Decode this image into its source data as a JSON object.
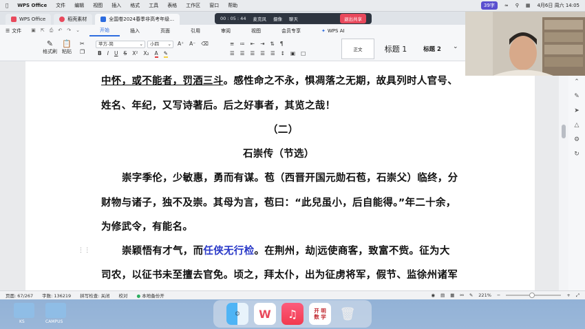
{
  "menubar": {
    "app": "WPS Office",
    "items": [
      "文件",
      "编辑",
      "视图",
      "插入",
      "格式",
      "工具",
      "表格",
      "工作区",
      "窗口",
      "帮助"
    ],
    "badge": "39字",
    "clock": "4月6日 周六 14:05"
  },
  "tabs": [
    {
      "label": "WPS Office",
      "color": "#e9495c"
    },
    {
      "label": "稻壳素材",
      "color": "#e9495c"
    },
    {
      "label": "全国卷2024春季非高考年级…",
      "color": "#2d6cdf"
    }
  ],
  "recording": {
    "time": "00 : 05 : 44",
    "mic": "麦克风",
    "camera": "摄像",
    "chat": "聊天",
    "stop": "退出共享"
  },
  "ribbon": {
    "file": "文件",
    "tabs": [
      "开始",
      "插入",
      "页面",
      "引用",
      "审阅",
      "视图",
      "会员专享"
    ],
    "active": "开始",
    "wpsai": "WPS AI",
    "format_painter": "格式刷",
    "paste": "粘贴",
    "font": "苹方-简",
    "size": "小四",
    "styles": [
      "正文",
      "标题 1",
      "标题 2"
    ]
  },
  "doc": {
    "l1a": "中怀，或不能者，罚酒三斗",
    "l1b": "。感性命之不永，惧凋落之无期，故具列时人官号、",
    "l2": "姓名、年纪，又写诗著后。后之好事者，其览之哉！",
    "l3": "（二）",
    "l4": "石崇传（节选）",
    "l5": "崇字季伦，少敏惠，勇而有谋。苞（西晋开国元勋石苞，石崇父）临终，分",
    "l6": "财物与诸子，独不及崇。其母为言，苞曰：“此兒虽小，后自能得。”年二十余，",
    "l7": "为修武令，有能名。",
    "l8a": "崇颖悟有才气，而",
    "l8b": "任侠无行检",
    "l8c": "。在荆州，劫",
    "l8d": "远使商客，致富不赀。征为大",
    "l9": "司农，以征书未至擅去官免。顷之，拜太仆，出为征虏将军，假节、监徐州诸军"
  },
  "status": {
    "page": "页面: 67/267",
    "words": "字数: 136219",
    "spell": "拼写检查: 关闭",
    "proof": "校对",
    "backup": "本地备份开",
    "zoom": "221%"
  },
  "dock": {
    "book_line1": "开 明",
    "book_line2": "数 学"
  },
  "desktop": [
    "KS",
    "CAMPUS"
  ]
}
